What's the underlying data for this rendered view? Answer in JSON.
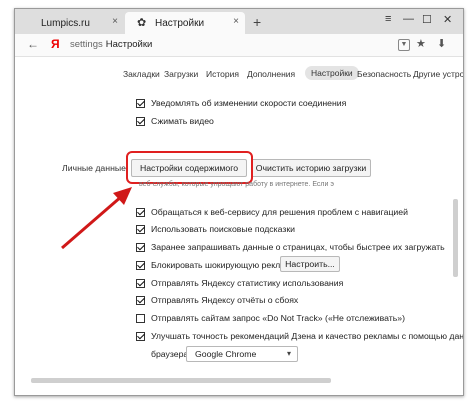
{
  "tabs": [
    {
      "label": "Lumpics.ru",
      "icon": "page-icon",
      "close": "×"
    },
    {
      "label": "Настройки",
      "icon": "gear-icon",
      "close": "×"
    }
  ],
  "newtab": "+",
  "window_controls": {
    "menu": "≡",
    "minimize": "—",
    "maximize": "☐",
    "close": "✕"
  },
  "address": {
    "back": "←",
    "logo": "Я",
    "url_prefix": "settings",
    "url_title": "Настройки",
    "star": "★",
    "download": "⬇",
    "menu": "≡"
  },
  "settings_tabs": [
    "Закладки",
    "Загрузки",
    "История",
    "Дополнения",
    "Настройки",
    "Безопасность",
    "Другие устройства"
  ],
  "active_tab_index": 4,
  "top_checks": [
    {
      "label": "Уведомлять об изменении скорости соединения",
      "checked": true
    },
    {
      "label": "Сжимать видео",
      "checked": true
    }
  ],
  "personal": {
    "section_label": "Личные данные",
    "content_settings_button": "Настройки содержимого",
    "clear_history_button": "Очистить историю загрузки",
    "description": "веб-службы, которые упрощают работу в интернете. Если э"
  },
  "privacy_checks": [
    {
      "label": "Обращаться к веб-сервису для решения проблем с навигацией",
      "checked": true
    },
    {
      "label": "Использовать поисковые подсказки",
      "checked": true
    },
    {
      "label": "Заранее запрашивать данные о страницах, чтобы быстрее их загружать",
      "checked": true
    },
    {
      "label": "Блокировать шокирующую рекламу",
      "checked": true,
      "button": "Настроить..."
    },
    {
      "label": "Отправлять Яндексу статистику использования",
      "checked": true
    },
    {
      "label": "Отправлять Яндексу отчёты о сбоях",
      "checked": true
    },
    {
      "label": "Отправлять сайтам запрос «Do Not Track» («Не отслеживать»)",
      "checked": false
    },
    {
      "label": "Улучшать точность рекомендаций Дзена и качество рекламы с помощью данных из",
      "checked": true
    }
  ],
  "browser_select": {
    "label": "браузера:",
    "value": "Google Chrome",
    "caret": "▾"
  },
  "colors": {
    "highlight": "#e02020",
    "arrow": "#d01818"
  }
}
